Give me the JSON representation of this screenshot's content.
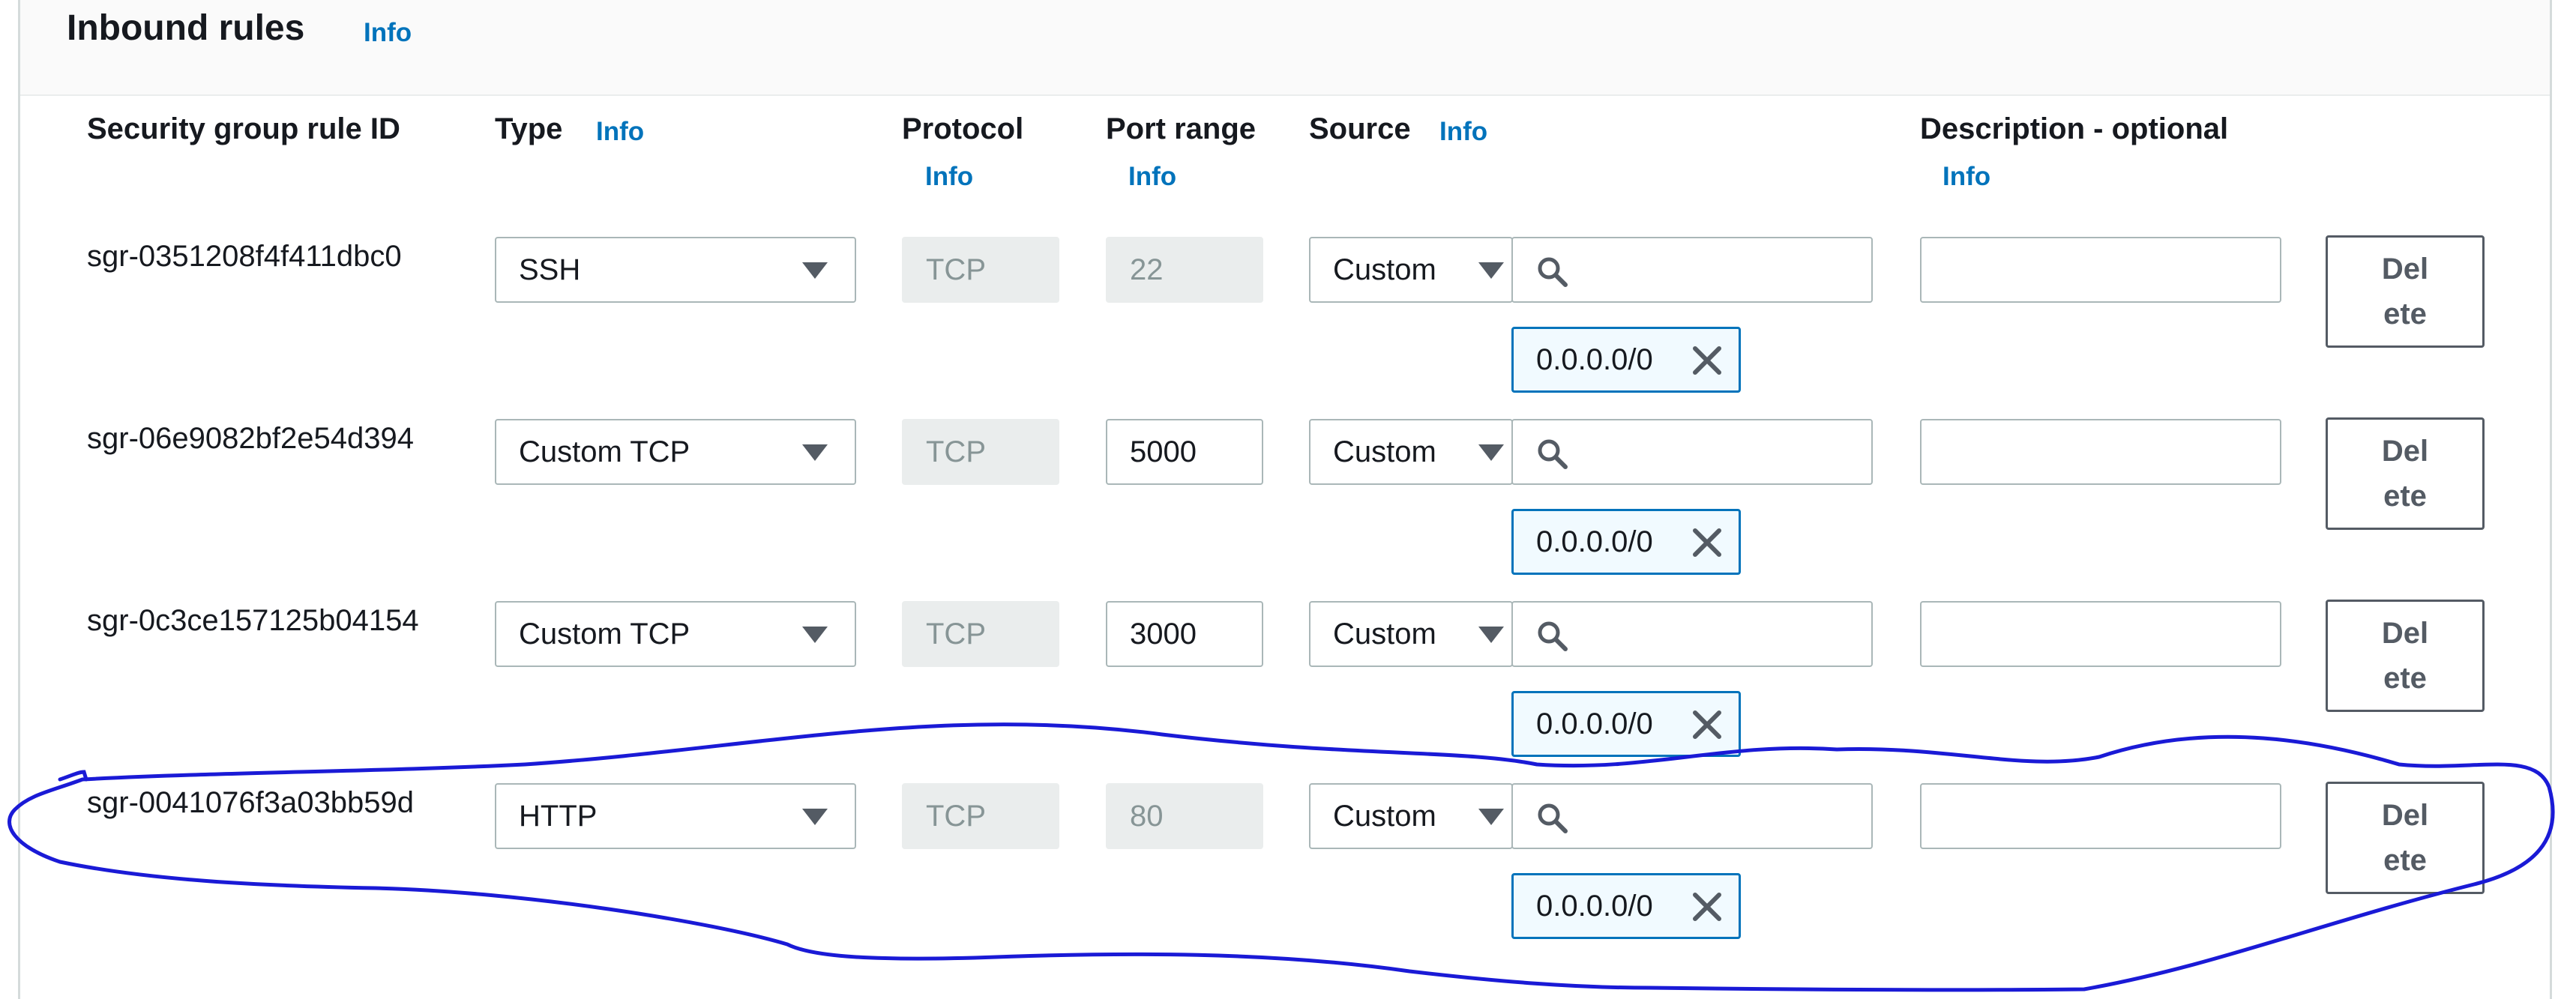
{
  "panel": {
    "title": "Inbound rules",
    "title_info": "Info"
  },
  "columns": {
    "rule_id": "Security group rule ID",
    "type": "Type",
    "type_info": "Info",
    "protocol": "Protocol",
    "protocol_info": "Info",
    "port_range": "Port range",
    "port_info": "Info",
    "source": "Source",
    "source_info": "Info",
    "description": "Description - optional",
    "description_info": "Info"
  },
  "rows": [
    {
      "id": "sgr-0351208f4f411dbc0",
      "type": "SSH",
      "protocol": "TCP",
      "port": "22",
      "source_mode": "Custom",
      "source_search": "",
      "cidr": "0.0.0.0/0",
      "description": "",
      "delete": "Del ete"
    },
    {
      "id": "sgr-06e9082bf2e54d394",
      "type": "Custom TCP",
      "protocol": "TCP",
      "port": "5000",
      "source_mode": "Custom",
      "source_search": "",
      "cidr": "0.0.0.0/0",
      "description": "",
      "delete": "Del ete"
    },
    {
      "id": "sgr-0c3ce157125b04154",
      "type": "Custom TCP",
      "protocol": "TCP",
      "port": "3000",
      "source_mode": "Custom",
      "source_search": "",
      "cidr": "0.0.0.0/0",
      "description": "",
      "delete": "Del ete"
    },
    {
      "id": "sgr-0041076f3a03bb59d",
      "type": "HTTP",
      "protocol": "TCP",
      "port": "80",
      "source_mode": "Custom",
      "source_search": "",
      "cidr": "0.0.0.0/0",
      "description": "",
      "delete": "Del ete"
    }
  ],
  "delete_label_lines": [
    "Del",
    "ete"
  ],
  "icons": {
    "dropdown": "caret-down-icon",
    "search": "search-icon",
    "remove": "close-icon"
  },
  "colors": {
    "link": "#0073bb",
    "annotation": "#1a1ad6",
    "token_border": "#0073bb",
    "disabled_bg": "#eaeded"
  }
}
